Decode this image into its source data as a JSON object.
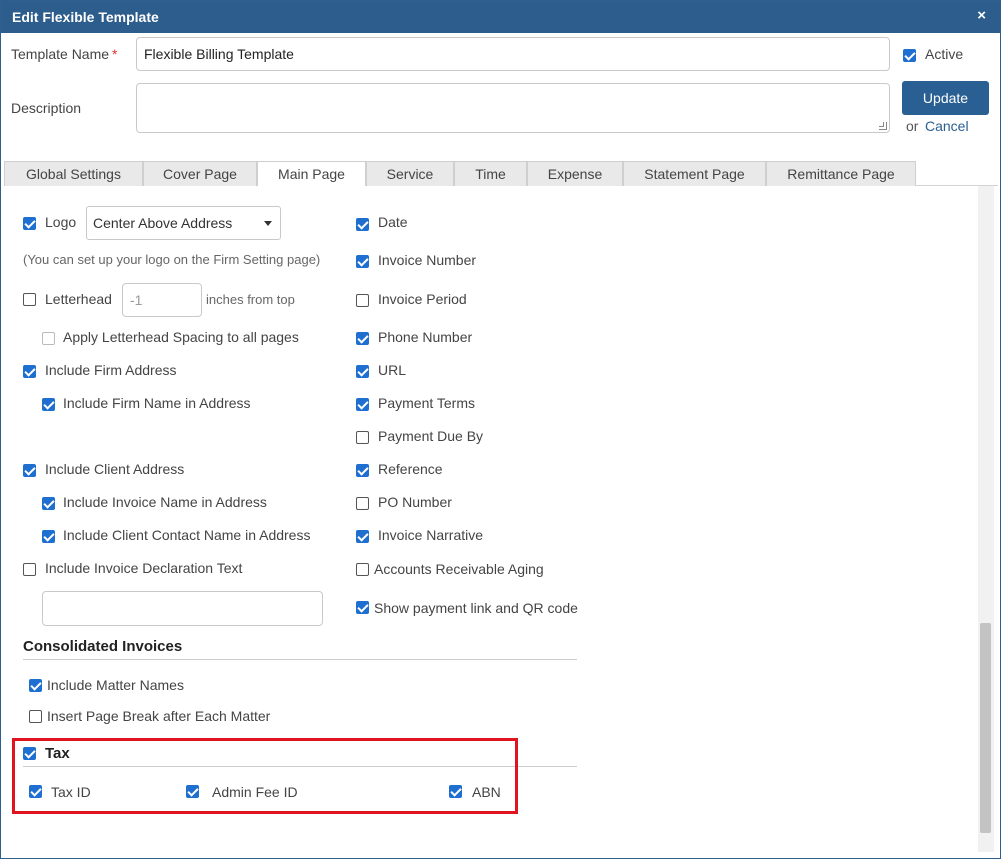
{
  "dialog": {
    "title": "Edit Flexible Template",
    "close_label": "×"
  },
  "form": {
    "template_name_label": "Template Name",
    "required_mark": "*",
    "template_name_value": "Flexible Billing Template",
    "description_label": "Description",
    "description_value": "",
    "active_label": "Active",
    "active_checked": true
  },
  "actions": {
    "update_label": "Update",
    "or_text": "or",
    "cancel_label": "Cancel"
  },
  "tabs": [
    {
      "label": "Global Settings",
      "active": false
    },
    {
      "label": "Cover Page",
      "active": false
    },
    {
      "label": "Main Page",
      "active": true
    },
    {
      "label": "Service",
      "active": false
    },
    {
      "label": "Time",
      "active": false
    },
    {
      "label": "Expense",
      "active": false
    },
    {
      "label": "Statement Page",
      "active": false
    },
    {
      "label": "Remittance Page",
      "active": false
    }
  ],
  "left": {
    "logo_label": "Logo",
    "logo_position": "Center Above Address",
    "logo_hint": "(You can set up your logo on the Firm Setting page)",
    "letterhead_label": "Letterhead",
    "letterhead_placeholder": "-1",
    "letterhead_unit": "inches from top",
    "apply_letterhead_label": "Apply Letterhead Spacing to all pages",
    "include_firm_address": "Include Firm Address",
    "include_firm_name": "Include Firm Name in Address",
    "include_client_address": "Include Client Address",
    "include_invoice_name": "Include Invoice Name in Address",
    "include_client_contact": "Include Client Contact Name in Address",
    "include_declaration": "Include Invoice Declaration Text",
    "declaration_value": ""
  },
  "right": {
    "date": "Date",
    "invoice_number": "Invoice Number",
    "invoice_period": "Invoice Period",
    "phone_number": "Phone Number",
    "url": "URL",
    "payment_terms": "Payment Terms",
    "payment_due_by": "Payment Due By",
    "reference": "Reference",
    "po_number": "PO Number",
    "invoice_narrative": "Invoice Narrative",
    "ar_aging": "Accounts Receivable Aging",
    "payment_link": "Show payment link and QR code"
  },
  "consolidated": {
    "heading": "Consolidated Invoices",
    "include_matter_names": "Include Matter Names",
    "page_break": "Insert Page Break after Each Matter"
  },
  "tax": {
    "heading": "Tax",
    "tax_id": "Tax ID",
    "admin_fee_id": "Admin Fee ID",
    "abn": "ABN"
  },
  "colors": {
    "titlebar": "#2c5d8c",
    "accent": "#1e6fcf",
    "highlight": "#e0141e"
  }
}
